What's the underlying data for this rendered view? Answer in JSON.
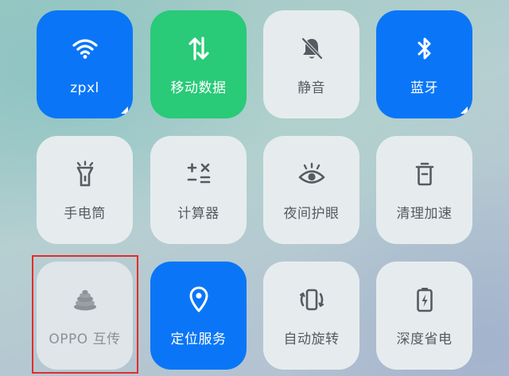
{
  "colors": {
    "active_blue": "#0a76f7",
    "active_green": "#29ca78",
    "inactive_tile": "#e6ecee",
    "inactive_text": "#555b60",
    "highlight": "#e52b2b"
  },
  "tiles": [
    {
      "label": "zpxl",
      "icon": "wifi-icon",
      "state": "active-blue",
      "has_expand": true
    },
    {
      "label": "移动数据",
      "icon": "mobile-data-icon",
      "state": "active-green",
      "has_expand": false
    },
    {
      "label": "静音",
      "icon": "bell-off-icon",
      "state": "inactive",
      "has_expand": false
    },
    {
      "label": "蓝牙",
      "icon": "bluetooth-icon",
      "state": "active-blue",
      "has_expand": true
    },
    {
      "label": "手电筒",
      "icon": "flashlight-icon",
      "state": "inactive",
      "has_expand": false
    },
    {
      "label": "计算器",
      "icon": "calculator-icon",
      "state": "inactive",
      "has_expand": false
    },
    {
      "label": "夜间护眼",
      "icon": "eye-icon",
      "state": "inactive",
      "has_expand": false
    },
    {
      "label": "清理加速",
      "icon": "trash-icon",
      "state": "inactive",
      "has_expand": false
    },
    {
      "label": "OPPO 互传",
      "icon": "oppo-share-icon",
      "state": "disabled",
      "has_expand": false
    },
    {
      "label": "定位服务",
      "icon": "location-pin-icon",
      "state": "active-blue",
      "has_expand": false
    },
    {
      "label": "自动旋转",
      "icon": "auto-rotate-icon",
      "state": "inactive",
      "has_expand": false
    },
    {
      "label": "深度省电",
      "icon": "battery-saver-icon",
      "state": "inactive",
      "has_expand": false
    }
  ]
}
